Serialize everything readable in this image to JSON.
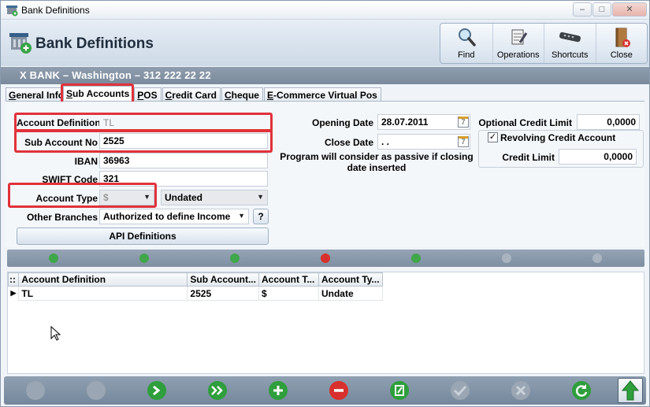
{
  "window": {
    "title": "Bank Definitions",
    "icon": "bank-app-icon"
  },
  "header": {
    "title": "Bank Definitions",
    "toolbar": [
      {
        "label": "Find",
        "icon": "magnifier-icon"
      },
      {
        "label": "Operations",
        "icon": "operations-icon"
      },
      {
        "label": "Shortcuts",
        "icon": "shortcuts-icon"
      },
      {
        "label": "Close",
        "icon": "close-door-icon"
      }
    ]
  },
  "infobar": {
    "text": "X BANK  –  Washington  –  312 222 22 22"
  },
  "tabs": [
    {
      "label": "General Info",
      "ul": "G",
      "rest": "eneral Info"
    },
    {
      "label": "Sub Accounts",
      "ul": "S",
      "rest": "ub Accounts",
      "active": true
    },
    {
      "label": "POS",
      "ul": "P",
      "rest": "OS"
    },
    {
      "label": "Credit Card",
      "ul": "C",
      "rest": "redit Card"
    },
    {
      "label": "Cheque",
      "ul": "C",
      "rest": "heque"
    },
    {
      "label": "E-Commerce Virtual Pos",
      "ul": "E",
      "rest": "-Commerce Virtual Pos"
    }
  ],
  "form": {
    "account_definition": {
      "label": "Account Definition",
      "value": "TL"
    },
    "sub_account_no": {
      "label": "Sub Account No",
      "value": "2525"
    },
    "iban": {
      "label": "IBAN",
      "value": "36963"
    },
    "swift": {
      "label": "SWIFT Code",
      "value": "321"
    },
    "account_type": {
      "label": "Account Type",
      "value": "$",
      "term": "Undated"
    },
    "other_branches": {
      "label": "Other Branches",
      "value": "Authorized to define Income",
      "help": "?"
    },
    "api_button": "API Definitions",
    "opening_date": {
      "label": "Opening Date",
      "value": "28.07.2011"
    },
    "close_date": {
      "label": "Close Date",
      "value": " . ."
    },
    "calendar_glyph": "7",
    "passive_note": "Program will consider as passive if closing date inserted",
    "optional_credit_limit": {
      "label": "Optional Credit Limit",
      "value": "0,0000"
    },
    "revolving": {
      "label": "Revolving Credit Account",
      "checked": true,
      "mark": "✓"
    },
    "credit_limit": {
      "label": "Credit Limit",
      "value": "0,0000"
    }
  },
  "grid": {
    "columns": [
      "Account Definition",
      "Sub Account...",
      "Account T...",
      "Account Ty..."
    ],
    "rows": [
      [
        "TL",
        "2525",
        "$",
        "Undate"
      ]
    ],
    "row_indicator": "▶",
    "header_glyph": "::"
  },
  "colors": {
    "highlight": "#e0323a",
    "accent": "#2a9d3a",
    "danger": "#d8302c"
  }
}
